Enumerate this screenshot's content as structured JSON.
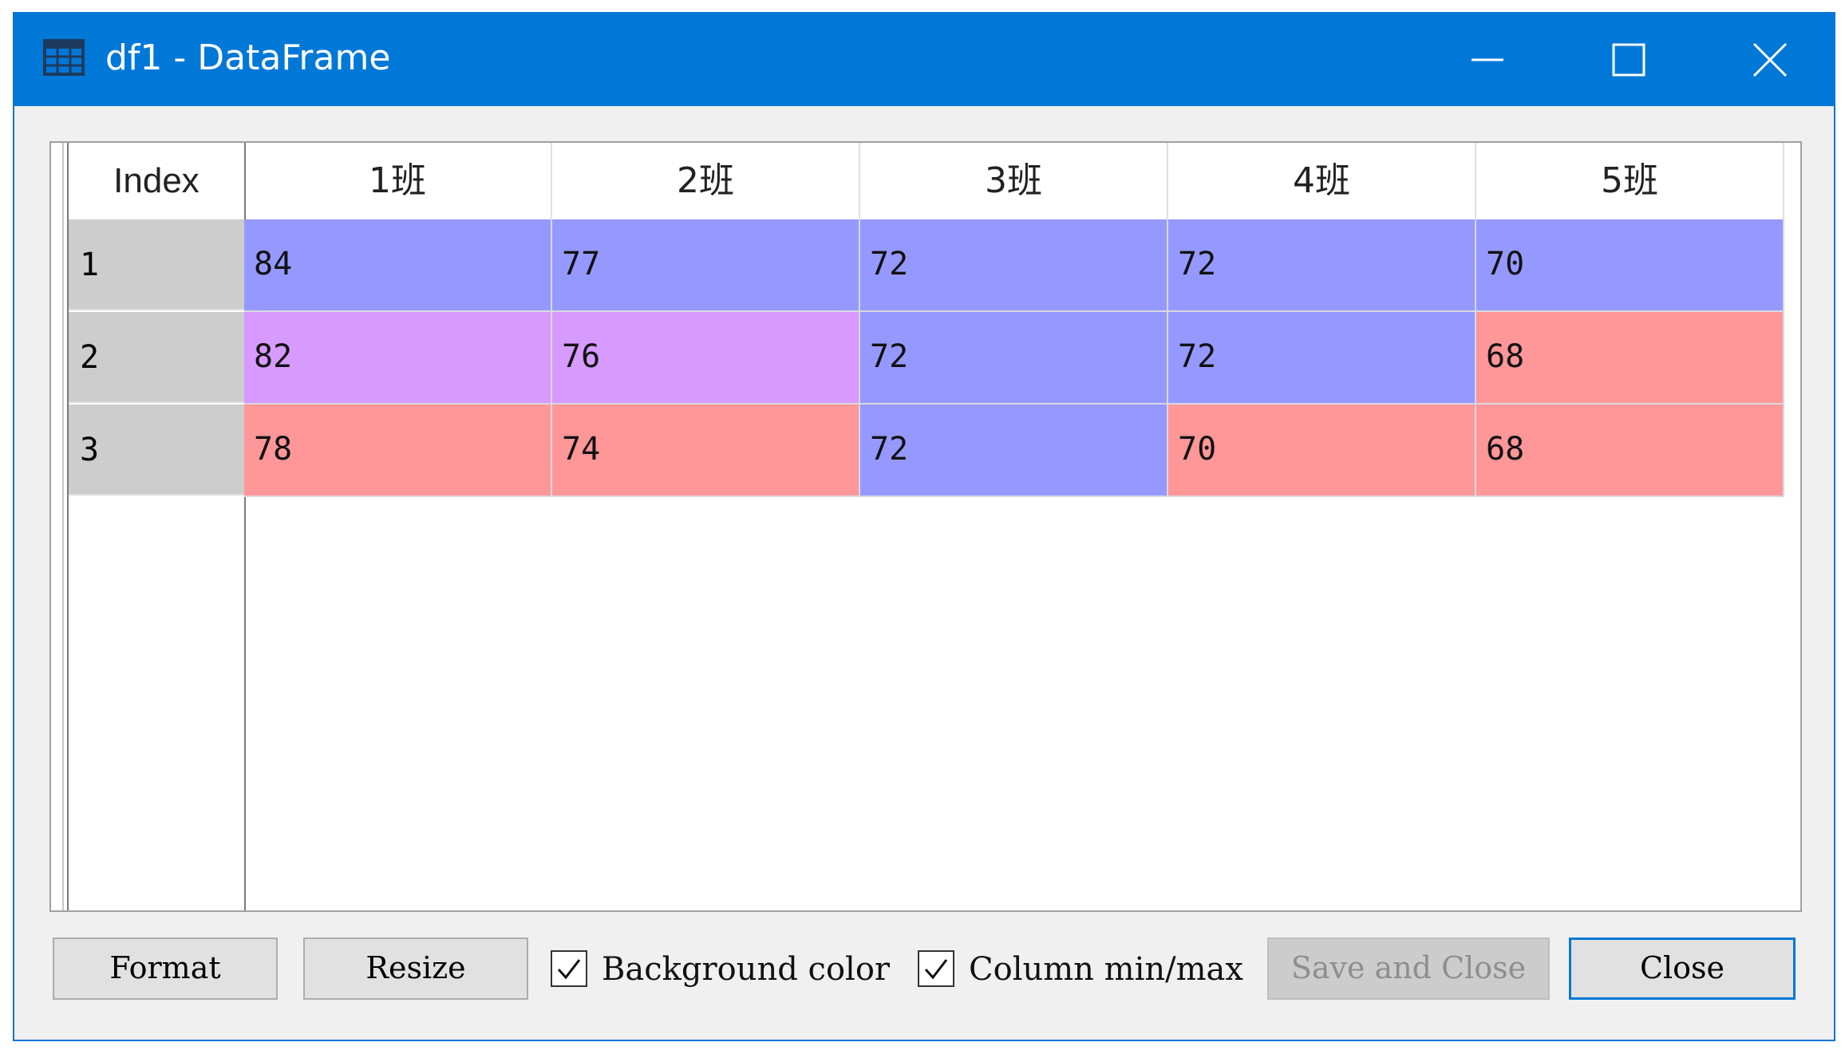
{
  "window": {
    "title": "df1 - DataFrame",
    "icon": "grid-icon"
  },
  "titlebar_buttons": [
    "minimize-icon",
    "maximize-icon",
    "close-icon"
  ],
  "table": {
    "index_header": "Index",
    "columns": [
      "1班",
      "2班",
      "3班",
      "4班",
      "5班"
    ],
    "rows": [
      {
        "index": "1",
        "values": [
          "84",
          "77",
          "72",
          "72",
          "70"
        ],
        "colors": [
          "#9599ff",
          "#9599ff",
          "#9599ff",
          "#9599ff",
          "#9599ff"
        ]
      },
      {
        "index": "2",
        "values": [
          "82",
          "76",
          "72",
          "72",
          "68"
        ],
        "colors": [
          "#d79aff",
          "#d79aff",
          "#9599ff",
          "#9599ff",
          "#ff9698"
        ]
      },
      {
        "index": "3",
        "values": [
          "78",
          "74",
          "72",
          "70",
          "68"
        ],
        "colors": [
          "#ff9698",
          "#ff9698",
          "#9599ff",
          "#ff9698",
          "#ff9698"
        ]
      }
    ]
  },
  "footer": {
    "format_label": "Format",
    "resize_label": "Resize",
    "bg_color_label": "Background color",
    "bg_color_checked": true,
    "col_minmax_label": "Column min/max",
    "col_minmax_checked": true,
    "save_close_label": "Save and Close",
    "save_close_enabled": false,
    "close_label": "Close"
  },
  "colors": {
    "titlebar": "#0078d7",
    "index_bg": "#cdcdcd",
    "accent": "#0078d7"
  }
}
